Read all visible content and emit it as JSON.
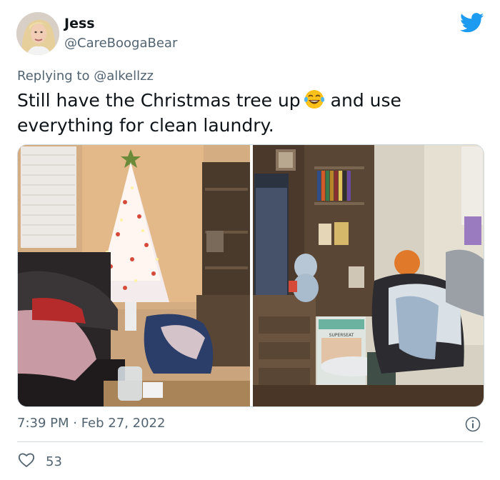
{
  "author": {
    "name": "Jess",
    "handle": "@CareBoogaBear"
  },
  "reply": {
    "prefix": "Replying to ",
    "mention": "@alkellzz"
  },
  "tweet": {
    "text_part1": "Still have the Christmas tree up",
    "emoji": "face-with-tears-of-joy",
    "text_part2": "and use everything for clean laundry."
  },
  "meta": {
    "timestamp": "7:39 PM · Feb 27, 2022"
  },
  "engagement": {
    "likes": "53"
  },
  "colors": {
    "twitter_blue": "#1d9bf0",
    "secondary_text": "#536471",
    "border": "#cfd9de"
  },
  "media": {
    "left_photo": "living-room-christmas-tree-laundry-photo",
    "right_photo": "bookshelf-laundry-pile-photo",
    "box_text": "SUPERSEAT"
  }
}
